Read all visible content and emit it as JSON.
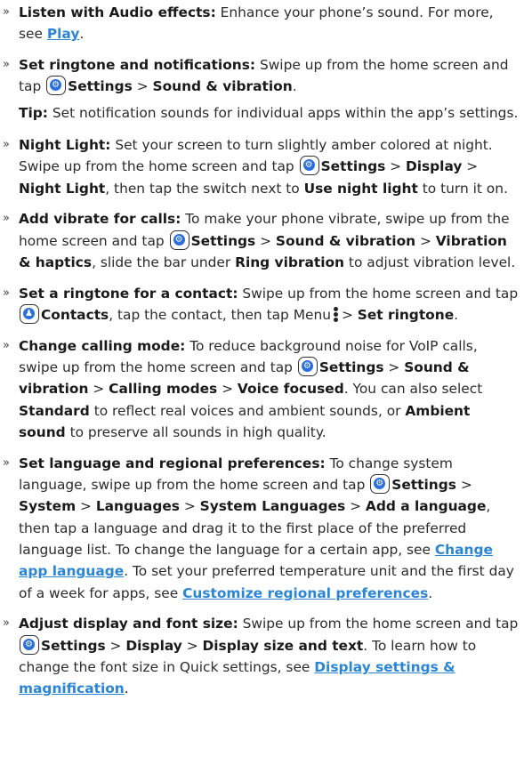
{
  "bullet": "»",
  "colors": {
    "link": "#2a86d4",
    "icon_fill": "#2a6fdb",
    "text": "#2b2b2b"
  },
  "icons": {
    "settings": "settings-gear-icon",
    "contacts": "contacts-icon",
    "menu": "menu-vertical-dots-icon"
  },
  "items": {
    "audio": {
      "title": "Listen with Audio effects:",
      "text": " Enhance your phone’s sound. For more, see ",
      "link": "Play",
      "end": "."
    },
    "ringtone": {
      "title": "Set ringtone and notifications:",
      "text": " Swipe up from the home screen and tap ",
      "settings": "Settings",
      "sep": " > ",
      "dest": "Sound & vibration",
      "end": ".",
      "tip_label": "Tip:",
      "tip_text": " Set notification sounds for individual apps within the app’s settings."
    },
    "nightlight": {
      "title": "Night Light:",
      "text": " Set your screen to turn slightly amber colored at night. Swipe up from the home screen and tap ",
      "settings": "Settings",
      "display": "Display",
      "night": "Night Light",
      "then": ", then tap the switch next to ",
      "use": "Use night light",
      "end": " to turn it on."
    },
    "vibrate": {
      "title": "Add vibrate for calls:",
      "text": " To make your phone vibrate, swipe up from the home screen and tap ",
      "settings": "Settings",
      "sound": "Sound & vibration",
      "haptics": "Vibration & haptics",
      "mid": ", slide the bar under ",
      "ring": "Ring vibration",
      "end": " to adjust vibration level."
    },
    "contact": {
      "title": "Set a ringtone for a contact:",
      "text": " Swipe up from the home screen and tap ",
      "contacts": "Contacts",
      "mid": ", tap the contact, then tap Menu",
      "set": "Set ringtone",
      "end": "."
    },
    "calling": {
      "title": "Change calling mode:",
      "text": " To reduce background noise for VoIP calls, swipe up from the home screen and tap ",
      "settings": "Settings",
      "sound": "Sound & vibration",
      "modes": "Calling modes",
      "voice": "Voice focused",
      "mid": ". You can also select ",
      "standard": "Standard",
      "mid2": " to reflect real voices and ambient sounds, or ",
      "ambient": "Ambient sound",
      "end": " to preserve all sounds in high quality."
    },
    "language": {
      "title": "Set language and regional preferences:",
      "text": " To change system language, swipe up from the home screen and tap ",
      "settings": "Settings",
      "system": "System",
      "languages": "Languages",
      "syslang": "System Languages",
      "add": "Add a language",
      "mid": ", then tap a language and drag it to the first place of the preferred language list. To change the language for a certain app, see ",
      "link1": "Change app language",
      "mid2": ". To set your preferred temperature unit and the first day of a week for apps, see ",
      "link2": "Customize regional preferences",
      "end": "."
    },
    "display": {
      "title": "Adjust display and font size:",
      "text": " Swipe up from the home screen and tap ",
      "settings": "Settings",
      "display": "Display",
      "size": "Display size and text",
      "mid": ". To learn how to change the font size in Quick settings, see ",
      "link": "Display settings & magnification",
      "end": "."
    }
  }
}
